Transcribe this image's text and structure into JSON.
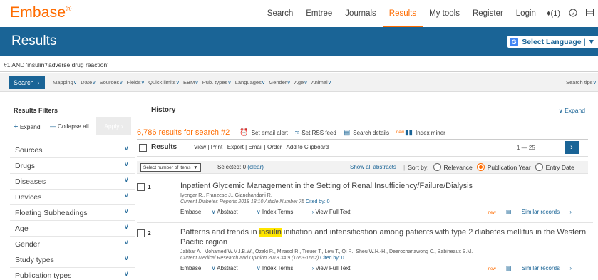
{
  "app": {
    "logo": "Embase",
    "logo_mark": "®"
  },
  "topnav": {
    "items": [
      "Search",
      "Emtree",
      "Journals",
      "Results",
      "My tools",
      "Register",
      "Login"
    ],
    "active": "Results",
    "notifications": "(1)",
    "help_icon": "help-circle-icon",
    "menu_icon": "menu-icon"
  },
  "header": {
    "title": "Results",
    "language_button": "Select Language",
    "language_arrow": "▼"
  },
  "query": {
    "text": "#1 AND 'insulin'/'adverse drug reaction'"
  },
  "searchbar": {
    "search_button": "Search",
    "filters": [
      "Mapping",
      "Date",
      "Sources",
      "Fields",
      "Quick limits",
      "EBM",
      "Pub. types",
      "Languages",
      "Gender",
      "Age",
      "Animal"
    ],
    "search_tips": "Search tips"
  },
  "results_filters": {
    "title": "Results Filters",
    "expand": "Expand",
    "collapse_all": "Collapse all",
    "apply": "Apply",
    "facets": [
      "Sources",
      "Drugs",
      "Diseases",
      "Devices",
      "Floating Subheadings",
      "Age",
      "Gender",
      "Study types",
      "Publication types"
    ]
  },
  "history": {
    "label": "History",
    "expand": "Expand"
  },
  "results_summary": {
    "count_text": "6,786 results for search #2",
    "actions": [
      "Set email alert",
      "Set RSS feed",
      "Search details",
      "Index miner"
    ],
    "new_badge": "new"
  },
  "results_bar": {
    "label": "Results",
    "actions": [
      "View",
      "Print",
      "Export",
      "Email",
      "Order",
      "Add to Clipboard"
    ],
    "separator": "|",
    "pagination": "1 — 25"
  },
  "sort": {
    "select_label": "Select number of items",
    "selected_text": "Selected:",
    "selected_count": "0",
    "clear": "(clear)",
    "show_abstracts": "Show all abstracts",
    "sort_by": "Sort by:",
    "options": [
      "Relevance",
      "Publication Year",
      "Entry Date"
    ],
    "selected_option": "Publication Year"
  },
  "results": [
    {
      "number": "1",
      "title": "Inpatient Glycemic Management in the Setting of Renal Insufficiency/Failure/Dialysis",
      "title_pre": "Inpatient Glycemic Management in the Setting of Renal Insufficiency/Failure/Dialysis",
      "title_highlight": "",
      "title_post": "",
      "authors": "Iyengar R., Franzese J., Gianchandani R.",
      "source": "Current Diabetes Reports 2018 18:10 Article Number 75",
      "cited_by": "Cited by: 0",
      "links": [
        "Embase",
        "Abstract",
        "Index Terms",
        "View Full Text"
      ],
      "similar": "Similar records"
    },
    {
      "number": "2",
      "title_pre": "Patterns and trends in ",
      "title_highlight": "insulin",
      "title_post": " initiation and intensification among patients with type 2 diabetes mellitus in the Western Pacific region",
      "authors": "Jabbar A., Mohamed W.M.I.B.W., Ozaki R., Mirasol R., Treuer T., Lew T., Qi R., Sheu W.H.-H., Deerochanawong C., Babineaux S.M.",
      "source": "Current Medical Research and Opinion 2018 34:9 (1653-1662)",
      "cited_by": "Cited by: 0",
      "links": [
        "Embase",
        "Abstract",
        "Index Terms",
        "View Full Text"
      ],
      "similar": "Similar records"
    }
  ],
  "colors": {
    "brand": "#ff6c00",
    "primary": "#1a6496",
    "highlight": "#ffe600"
  }
}
